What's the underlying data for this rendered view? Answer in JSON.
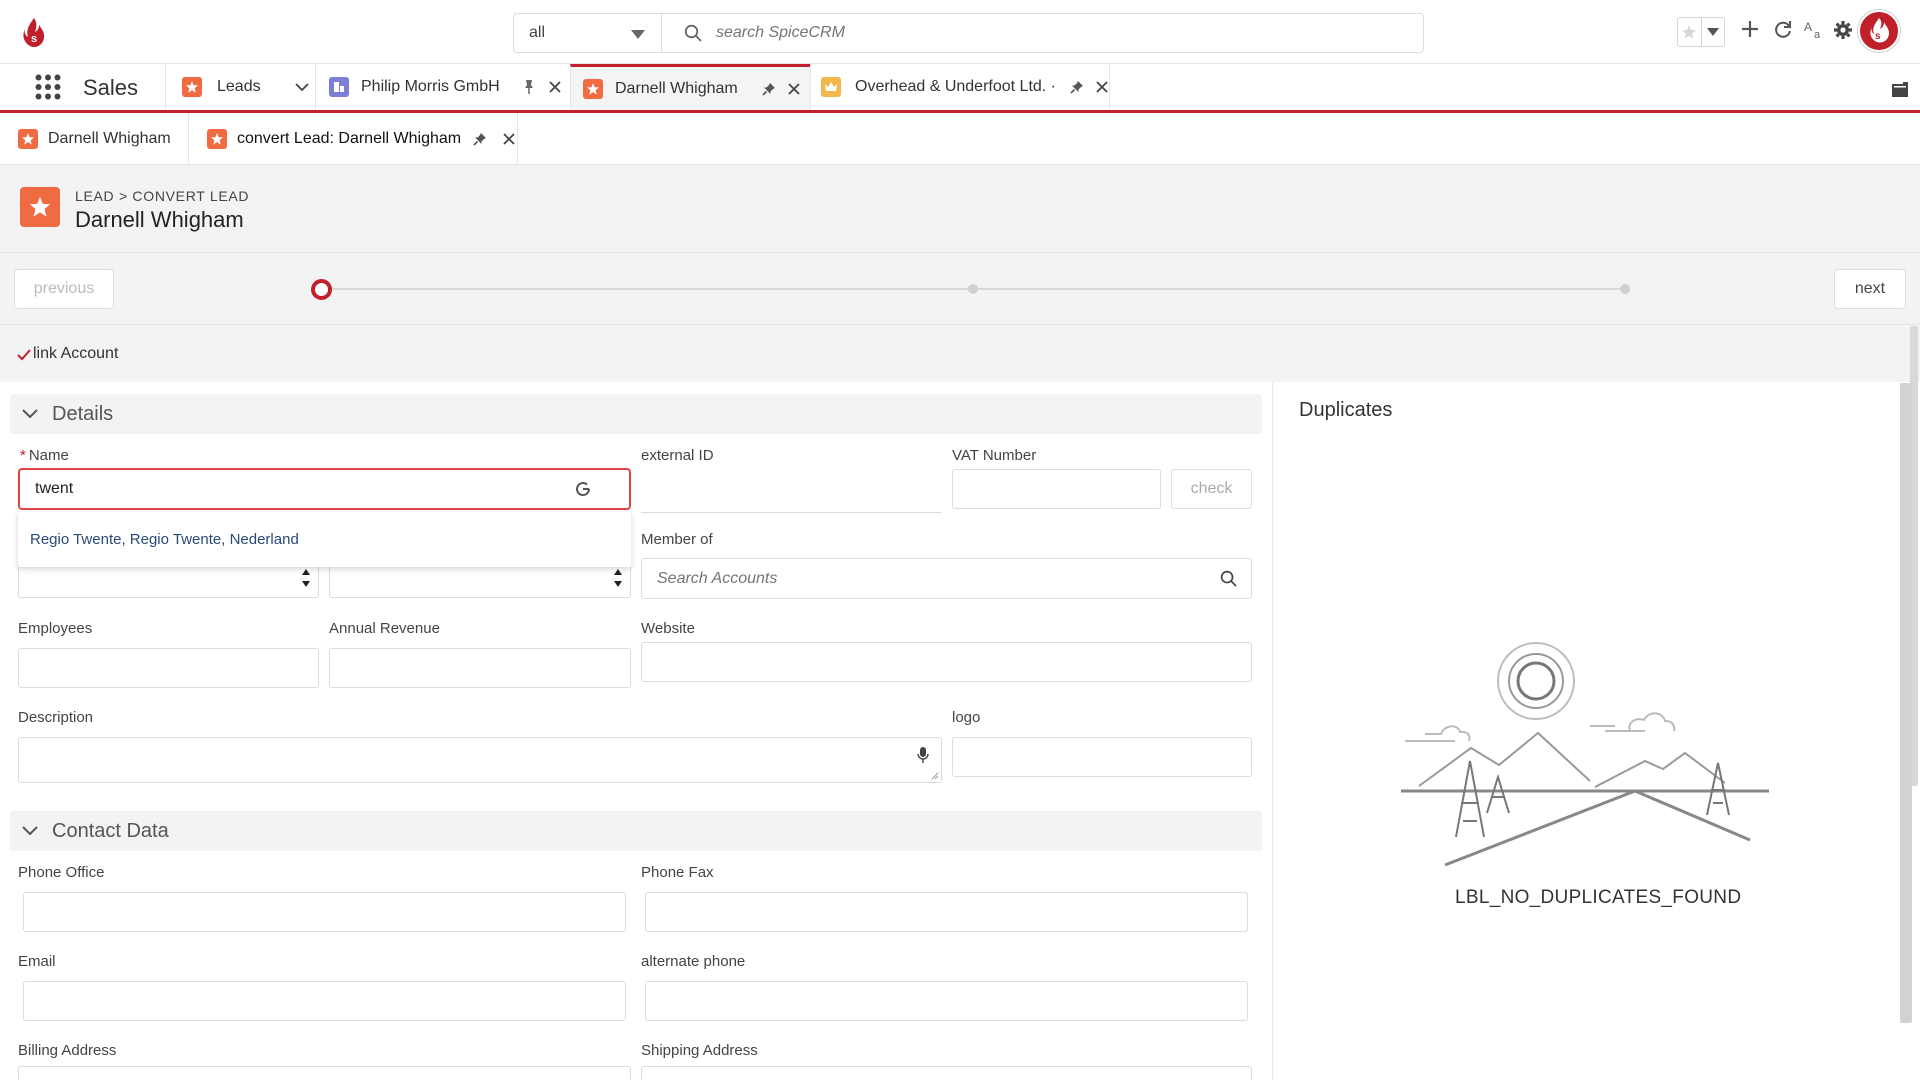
{
  "topbar": {
    "scope_value": "all",
    "search_placeholder": "search SpiceCRM"
  },
  "apps": {
    "current": "Sales"
  },
  "tabs": [
    {
      "label": "Leads",
      "icon": "lead-icon",
      "color": "#f06b42"
    },
    {
      "label": "Philip Morris GmbH",
      "icon": "account-icon",
      "color": "#7b7fd6"
    },
    {
      "label": "Darnell Whigham",
      "icon": "lead-icon",
      "color": "#f06b42"
    },
    {
      "label": "Overhead & Underfoot Ltd. ·",
      "icon": "opportunity-icon",
      "color": "#f2b84b"
    }
  ],
  "subtabs": [
    {
      "label": "Darnell Whigham"
    },
    {
      "label": "convert Lead: Darnell Whigham"
    }
  ],
  "header": {
    "breadcrumb": "LEAD > CONVERT LEAD",
    "title": "Darnell Whigham"
  },
  "wizard": {
    "previous_label": "previous",
    "next_label": "next",
    "current_step": 1,
    "total_steps": 3
  },
  "link_account": {
    "label": "link Account",
    "checked": true
  },
  "details": {
    "section_label": "Details",
    "name_label": "Name",
    "name_value": "twent",
    "name_suggestion": "Regio Twente, Regio Twente, Nederland",
    "external_id_label": "external ID",
    "vat_label": "VAT Number",
    "check_label": "check",
    "member_of_label": "Member of",
    "member_of_placeholder": "Search Accounts",
    "employees_label": "Employees",
    "annual_revenue_label": "Annual Revenue",
    "website_label": "Website",
    "description_label": "Description",
    "logo_label": "logo"
  },
  "contact": {
    "section_label": "Contact Data",
    "phone_office_label": "Phone Office",
    "phone_fax_label": "Phone Fax",
    "email_label": "Email",
    "alternate_phone_label": "alternate phone",
    "billing_label": "Billing Address",
    "shipping_label": "Shipping Address"
  },
  "duplicates": {
    "title": "Duplicates",
    "message": "LBL_NO_DUPLICATES_FOUND"
  },
  "colors": {
    "brand": "#c0202a",
    "lead": "#f06b42"
  }
}
